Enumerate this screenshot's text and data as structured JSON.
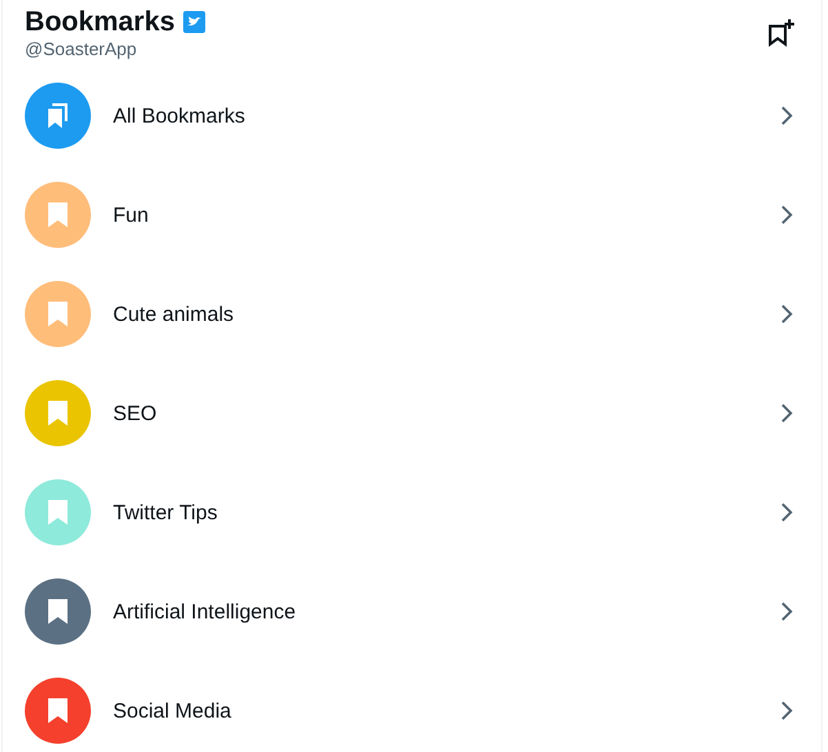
{
  "header": {
    "title": "Bookmarks",
    "handle": "@SoasterApp"
  },
  "folders": [
    {
      "kind": "all",
      "name": "All Bookmarks",
      "color": "#1d9bf0"
    },
    {
      "kind": "folder",
      "name": "Fun",
      "color": "#ffbd7a"
    },
    {
      "kind": "folder",
      "name": "Cute animals",
      "color": "#ffbd7a"
    },
    {
      "kind": "folder",
      "name": "SEO",
      "color": "#eac400"
    },
    {
      "kind": "folder",
      "name": "Twitter Tips",
      "color": "#8eeadb"
    },
    {
      "kind": "folder",
      "name": "Artificial Intelligence",
      "color": "#5b7083"
    },
    {
      "kind": "folder",
      "name": "Social Media",
      "color": "#f4402c"
    }
  ]
}
